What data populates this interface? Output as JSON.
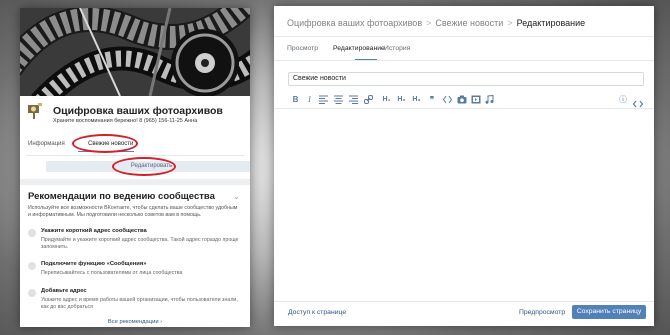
{
  "community": {
    "title": "Оцифровка ваших фотоархивов",
    "subtitle": "Храните воспоминания бережно! 8 (965) 156-11-25 Анна",
    "tabs": [
      "Информация",
      "Свежие новости"
    ],
    "edit_button": "Редактировать"
  },
  "recommendations": {
    "title": "Рекомендации по ведению сообщества",
    "description": "Используйте все возможности ВКонтакте, чтобы сделать ваше сообщество удобным и информативным. Мы подготовили несколько советов вам в помощь.",
    "items": [
      {
        "title": "Укажите короткий адрес сообщества",
        "desc": "Придумайте и укажите короткий адрес сообщества. Такой адрес гораздо проще запомнить."
      },
      {
        "title": "Подключите функцию «Сообщения»",
        "desc": "Переписывайтесь с пользователями от лица сообщества"
      },
      {
        "title": "Добавьте адрес",
        "desc": "Укажите адрес и время работы вашей организации, чтобы пользователи знали, как до вас добраться"
      }
    ],
    "all_link": "Все рекомендации ›"
  },
  "editor": {
    "breadcrumb": [
      "Оцифровка ваших фотоархивов",
      "Свежие новости",
      "Редактирование"
    ],
    "breadcrumb_sep": ">",
    "tabs": [
      "Просмотр",
      "Редактирование",
      "История"
    ],
    "active_tab": "Редактирование",
    "title_value": "Свежие новости",
    "toolbar": {
      "bold": "B",
      "italic": "I",
      "h1": "H₁",
      "h2": "H₂",
      "h3": "H₃",
      "quote": "❞",
      "info": "ⓘ"
    },
    "footer": {
      "back_link": "Доступ к странице",
      "preview": "Предпросмотр",
      "save": "Сохранить страницу"
    },
    "accent_color": "#5181b8"
  }
}
